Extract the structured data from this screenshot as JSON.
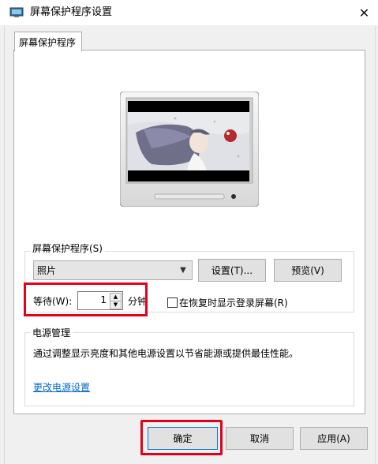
{
  "window": {
    "title": "屏幕保护程序设置",
    "close_symbol": "✕"
  },
  "tabs": [
    {
      "label": "屏幕保护程序"
    }
  ],
  "screensaver": {
    "group_label": "屏幕保护程序(S)",
    "selected": "照片",
    "settings_button": "设置(T)...",
    "preview_button": "预览(V)",
    "wait_label": "等待(W):",
    "wait_value": "1",
    "minutes_label": "分钟",
    "resume_checkbox_label": "在恢复时显示登录屏幕(R)",
    "resume_checked": false
  },
  "power": {
    "group_label": "电源管理",
    "description": "通过调整显示亮度和其他电源设置以节省能源或提供最佳性能。",
    "link": "更改电源设置"
  },
  "footer": {
    "ok": "确定",
    "cancel": "取消",
    "apply": "应用(A)"
  },
  "colors": {
    "highlight": "#e3001b",
    "link": "#0066cc",
    "accent": "#0078d7"
  }
}
